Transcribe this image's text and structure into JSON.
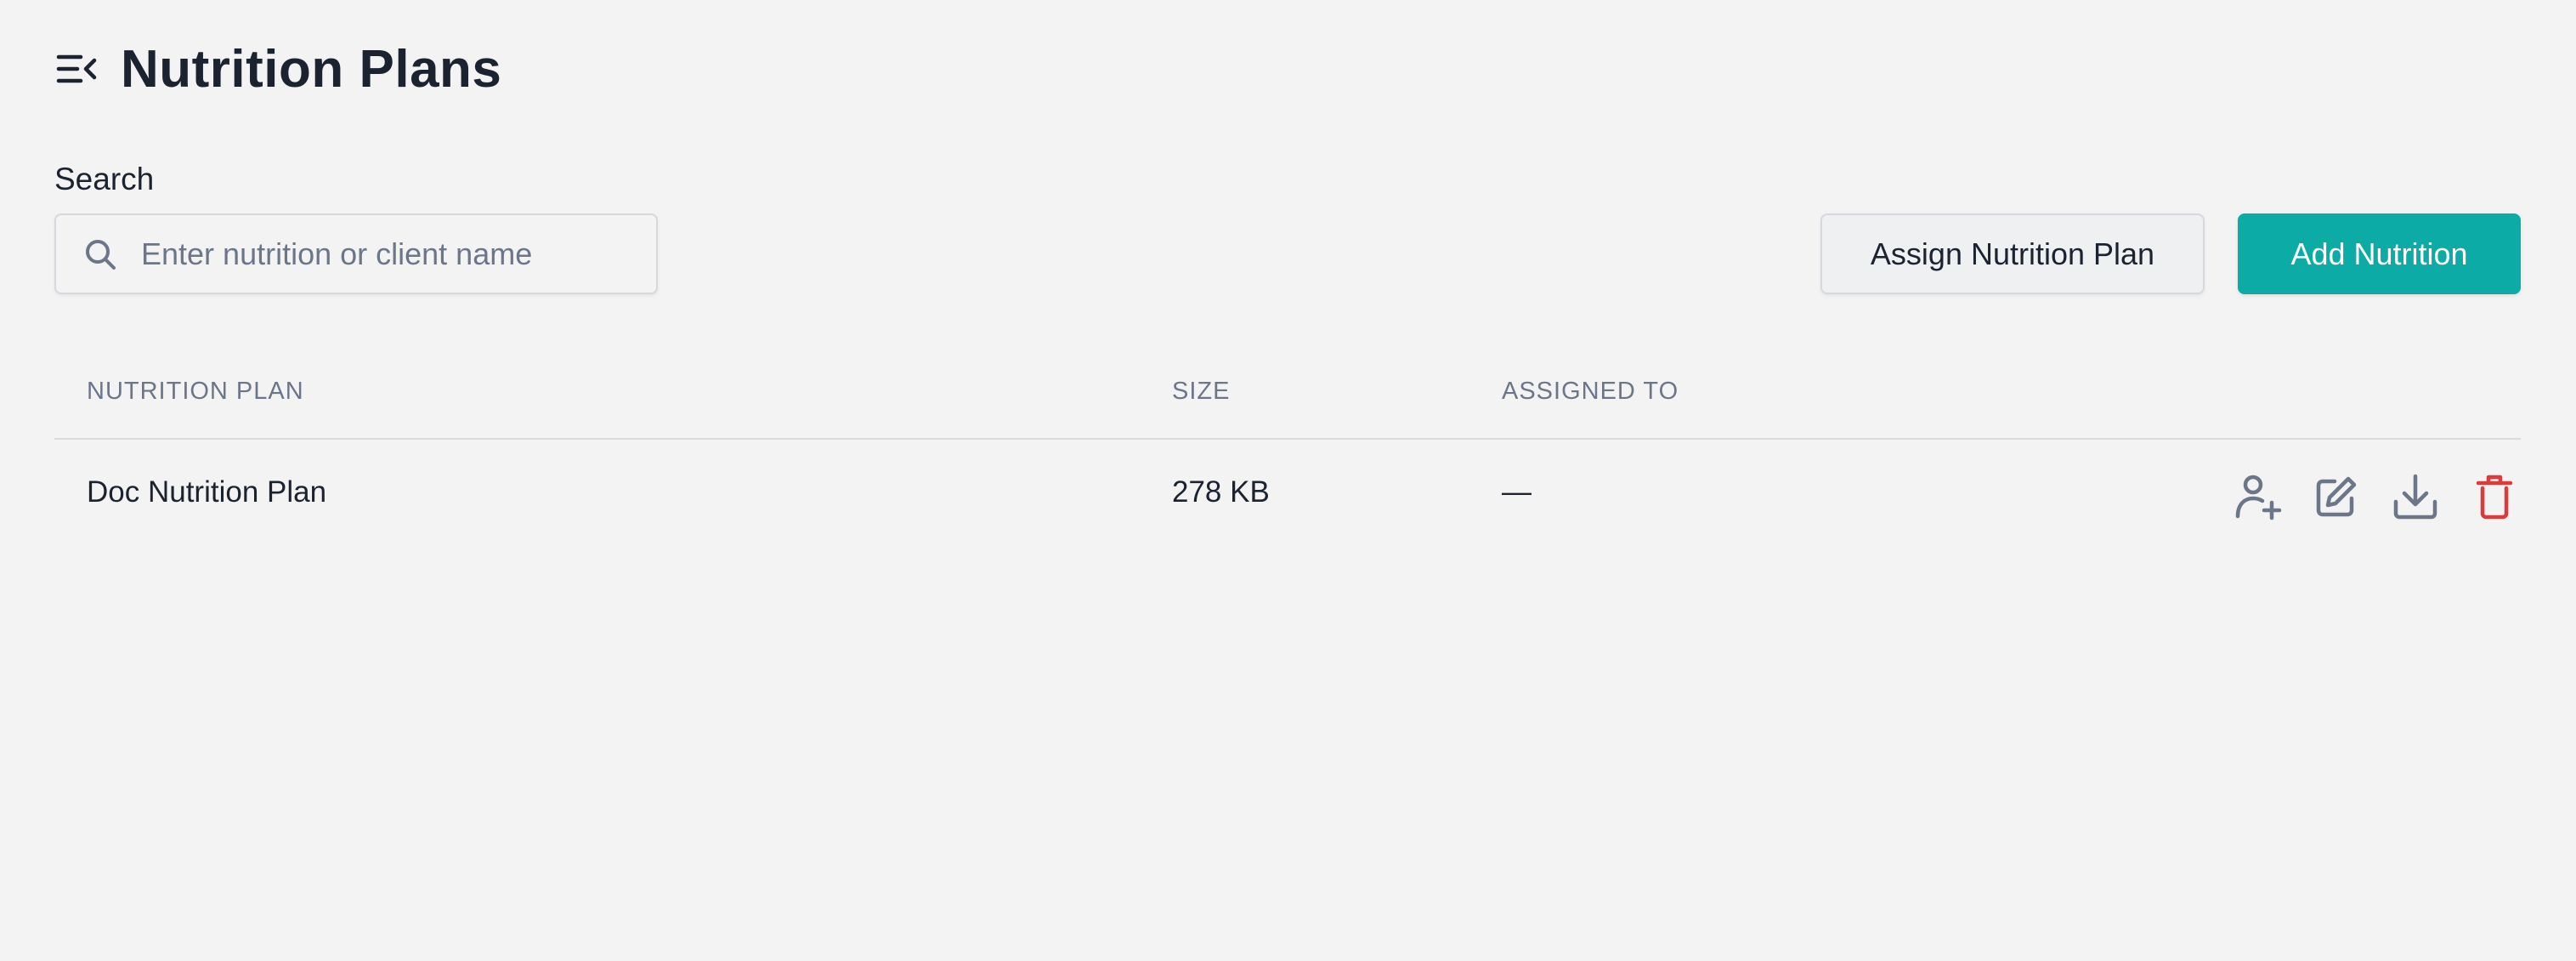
{
  "header": {
    "title": "Nutrition Plans",
    "menu_icon": "menu-collapse-icon"
  },
  "search": {
    "label": "Search",
    "placeholder": "Enter nutrition or client name",
    "value": "",
    "icon": "search-icon"
  },
  "actions": {
    "assign_label": "Assign Nutrition Plan",
    "add_label": "Add Nutrition"
  },
  "table": {
    "columns": [
      "NUTRITION PLAN",
      "SIZE",
      "ASSIGNED TO"
    ],
    "rows": [
      {
        "name": "Doc Nutrition Plan",
        "size": "278 KB",
        "assigned_to": "—",
        "row_actions": [
          "assign-user-icon",
          "edit-icon",
          "download-icon",
          "delete-icon"
        ]
      }
    ]
  },
  "colors": {
    "background": "#f3f3f3",
    "primary": "#0daba5",
    "text": "#1b2331",
    "muted": "#6b7689",
    "danger": "#dc3b3b"
  }
}
